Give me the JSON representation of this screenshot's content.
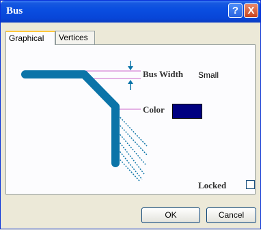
{
  "window": {
    "title": "Bus"
  },
  "titlebar": {
    "help_label": "?",
    "close_label": "X"
  },
  "tabs": [
    {
      "label": "Graphical",
      "active": true
    },
    {
      "label": "Vertices",
      "active": false
    }
  ],
  "graphical": {
    "bus_width_label": "Bus Width",
    "bus_width_value": "Small",
    "color_label": "Color",
    "color_value": "#000080",
    "locked_label": "Locked",
    "locked_checked": false
  },
  "buttons": {
    "ok": "OK",
    "cancel": "Cancel"
  },
  "colors": {
    "bus": "#0b74a8",
    "guide": "#cc66cc",
    "arrow": "#0b74a8"
  }
}
